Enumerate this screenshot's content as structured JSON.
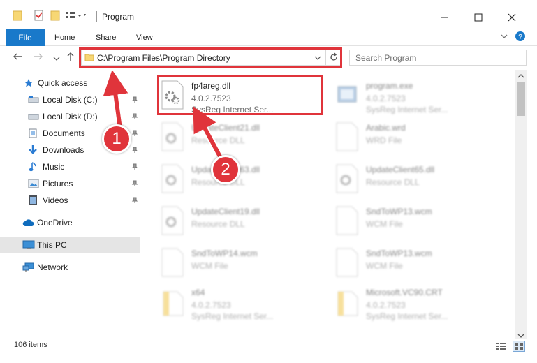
{
  "window": {
    "title": "Program",
    "minimize_icon": "minimize-icon",
    "maximize_icon": "maximize-icon",
    "close_icon": "close-icon"
  },
  "ribbon": {
    "file": "File",
    "home": "Home",
    "share": "Share",
    "view": "View"
  },
  "address": {
    "path": "C:\\Program Files\\Program Directory",
    "search_placeholder": "Search Program"
  },
  "sidebar": {
    "items": [
      {
        "label": "Quick access",
        "icon": "star-icon"
      },
      {
        "label": "Local Disk (C:)",
        "icon": "drive-icon"
      },
      {
        "label": "Local Disk (D:)",
        "icon": "drive-icon"
      },
      {
        "label": "Documents",
        "icon": "documents-icon"
      },
      {
        "label": "Downloads",
        "icon": "downloads-icon"
      },
      {
        "label": "Music",
        "icon": "music-icon"
      },
      {
        "label": "Pictures",
        "icon": "pictures-icon"
      },
      {
        "label": "Videos",
        "icon": "videos-icon"
      },
      {
        "label": "OneDrive",
        "icon": "cloud-icon"
      },
      {
        "label": "This PC",
        "icon": "computer-icon"
      },
      {
        "label": "Network",
        "icon": "network-icon"
      }
    ]
  },
  "files": [
    {
      "name": "fp4areg.dll",
      "line2": "4.0.2.7523",
      "line3": "SysReg Internet Ser...",
      "type": "dll"
    },
    {
      "name": "program.exe",
      "line2": "4.0.2.7523",
      "line3": "SysReg Internet Ser...",
      "type": "exe"
    },
    {
      "name": "UpdateClient21.dll",
      "line2": "Resource DLL",
      "line3": "",
      "type": "dll"
    },
    {
      "name": "Arabic.wrd",
      "line2": "WRD File",
      "line3": "",
      "type": "doc"
    },
    {
      "name": "UpdateClient63.dll",
      "line2": "Resource DLL",
      "line3": "",
      "type": "dll"
    },
    {
      "name": "UpdateClient65.dll",
      "line2": "Resource DLL",
      "line3": "",
      "type": "dll"
    },
    {
      "name": "UpdateClient19.dll",
      "line2": "Resource DLL",
      "line3": "",
      "type": "dll"
    },
    {
      "name": "SndToWP13.wcm",
      "line2": "WCM File",
      "line3": "",
      "type": "doc"
    },
    {
      "name": "SndToWP14.wcm",
      "line2": "WCM File",
      "line3": "",
      "type": "doc"
    },
    {
      "name": "SndToWP13.wcm",
      "line2": "WCM File",
      "line3": "",
      "type": "doc"
    },
    {
      "name": "x64",
      "line2": "4.0.2.7523",
      "line3": "SysReg Internet Ser...",
      "type": "folder"
    },
    {
      "name": "Microsoft.VC90.CRT",
      "line2": "4.0.2.7523",
      "line3": "SysReg Internet Ser...",
      "type": "folder"
    }
  ],
  "status": {
    "count": "106 items"
  },
  "callouts": [
    "1",
    "2"
  ],
  "colors": {
    "accent": "#1979ca",
    "highlight": "#e0343b"
  }
}
